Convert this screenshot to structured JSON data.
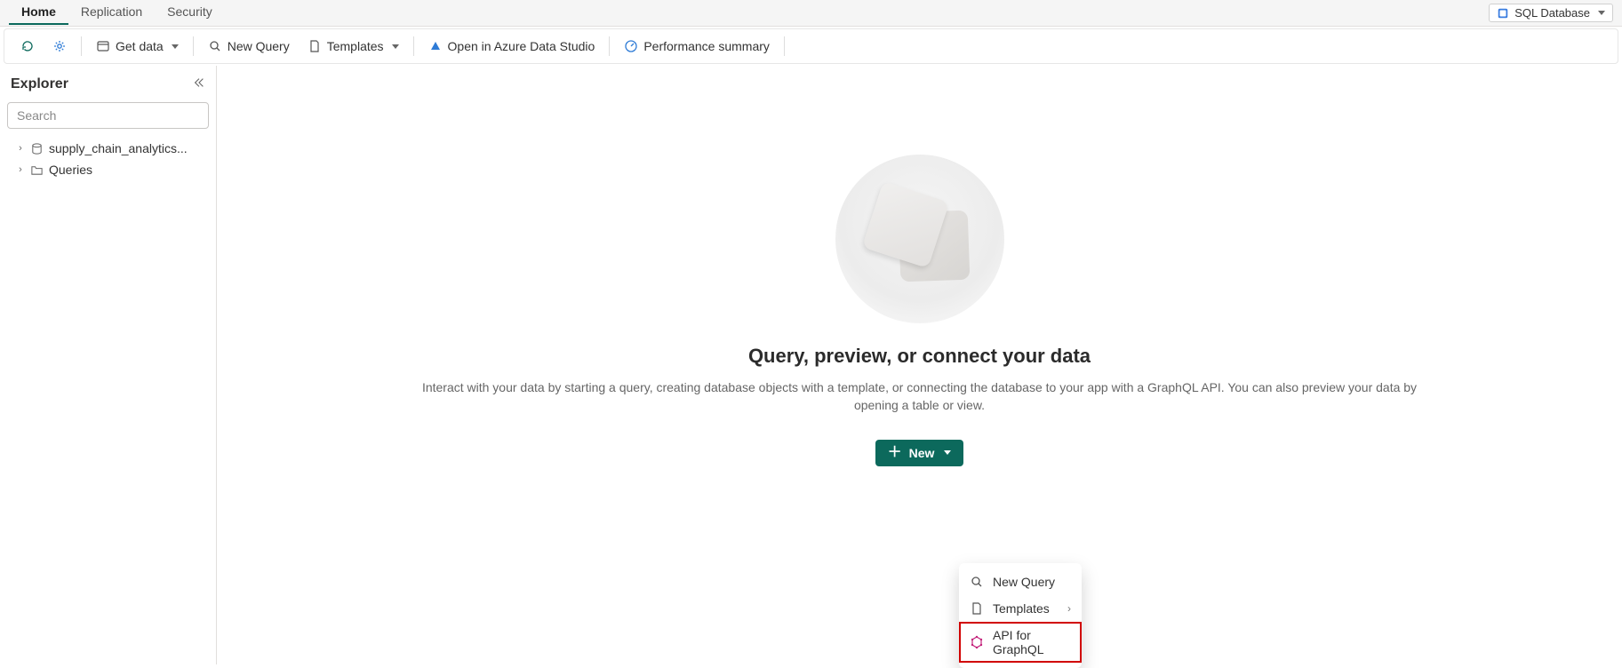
{
  "tabs": {
    "home": "Home",
    "replication": "Replication",
    "security": "Security"
  },
  "dbSelector": "SQL Database",
  "toolbar": {
    "getData": "Get data",
    "newQuery": "New Query",
    "templates": "Templates",
    "openAzure": "Open in Azure Data Studio",
    "perfSummary": "Performance summary"
  },
  "sidebar": {
    "title": "Explorer",
    "searchPlaceholder": "Search",
    "items": {
      "db": "supply_chain_analytics...",
      "queries": "Queries"
    }
  },
  "hero": {
    "title": "Query, preview, or connect your data",
    "sub": "Interact with your data by starting a query, creating database objects with a template, or connecting the database to your app with a GraphQL API. You can also preview your data by opening a table or view.",
    "newBtn": "New"
  },
  "dropdown": {
    "newQuery": "New Query",
    "templates": "Templates",
    "graphql": "API for GraphQL"
  }
}
